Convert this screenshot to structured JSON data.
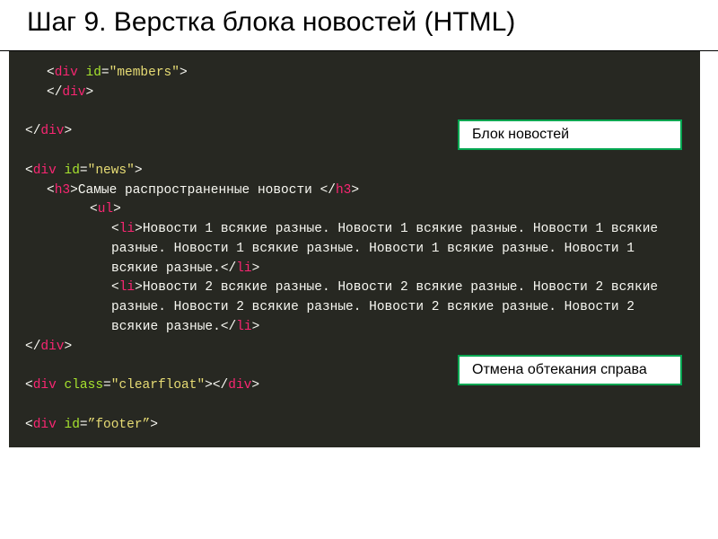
{
  "title": "Шаг 9. Верстка блока новостей (HTML)",
  "labels": {
    "news_block": "Блок новостей",
    "clearfloat": "Отмена обтекания справа"
  },
  "code": {
    "punct_open": "<",
    "punct_close": ">",
    "punct_close_end": "</",
    "div": "div",
    "h3": "h3",
    "ul": "ul",
    "li": "li",
    "id_attr": "id",
    "class_attr": "class",
    "eq": "=",
    "q": "\"",
    "members": "members",
    "news": "news",
    "clearfloat_val": "clearfloat",
    "footer": "footer",
    "curly_q": "”",
    "h3_text": "Самые распространенные новости ",
    "li1_text": "Новости 1 всякие разные. Новости 1 всякие разные. Новости 1 всякие разные. Новости 1 всякие разные. Новости 1 всякие разные. Новости 1 всякие разные.",
    "li2_text": "Новости 2 всякие разные. Новости 2 всякие разные. Новости 2 всякие разные. Новости 2 всякие разные. Новости 2 всякие разные. Новости 2 всякие разные."
  }
}
